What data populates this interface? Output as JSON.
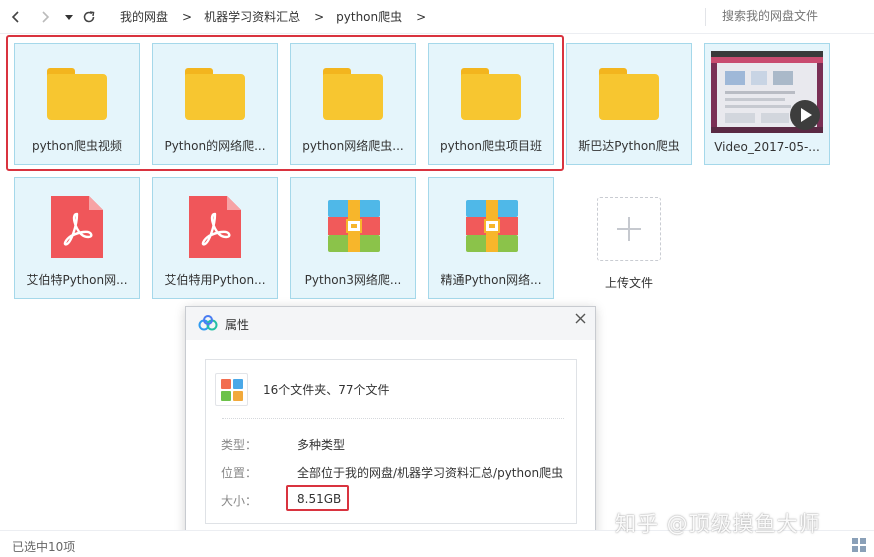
{
  "toolbar": {
    "back_icon": "chevron-left-icon",
    "forward_icon": "chevron-right-icon",
    "history_icon": "caret-down-icon",
    "refresh_icon": "refresh-icon",
    "breadcrumb": [
      "我的网盘",
      "机器学习资料汇总",
      "python爬虫"
    ],
    "search_placeholder": "搜索我的网盘文件"
  },
  "files": [
    {
      "name": "python爬虫视频",
      "type": "folder",
      "selected": true
    },
    {
      "name": "Python的网络爬...",
      "type": "folder",
      "selected": true
    },
    {
      "name": "python网络爬虫...",
      "type": "folder",
      "selected": true
    },
    {
      "name": "python爬虫项目班",
      "type": "folder",
      "selected": true
    },
    {
      "name": "斯巴达Python爬虫",
      "type": "folder",
      "selected": true
    },
    {
      "name": "Video_2017-05-...",
      "type": "video",
      "selected": true
    },
    {
      "name": "艾伯特Python网...",
      "type": "pdf",
      "selected": true
    },
    {
      "name": "艾伯特用Python...",
      "type": "pdf",
      "selected": true
    },
    {
      "name": "Python3网络爬...",
      "type": "archive",
      "selected": true
    },
    {
      "name": "精通Python网络...",
      "type": "archive",
      "selected": true
    }
  ],
  "upload": {
    "label": "上传文件",
    "icon": "plus-icon"
  },
  "status": {
    "selected_text": "已选中10项",
    "view_icon": "grid-view-icon"
  },
  "dialog": {
    "title": "属性",
    "logo_icon": "baidu-cloud-icon",
    "close_icon": "close-icon",
    "summary": "16个文件夹、77个文件",
    "rows": [
      {
        "label": "类型：",
        "value": "多种类型"
      },
      {
        "label": "位置：",
        "value": "全部位于我的网盘/机器学习资料汇总/python爬虫"
      },
      {
        "label": "大小：",
        "value": "8.51GB"
      }
    ]
  },
  "watermark": "知乎 @顶级摸鱼大师",
  "colors": {
    "selection_bg": "#e5f5fb",
    "selection_border": "#a5d8ea",
    "highlight_red": "#d9333f",
    "folder_yellow": "#f7c630",
    "pdf_red": "#f0565a"
  }
}
